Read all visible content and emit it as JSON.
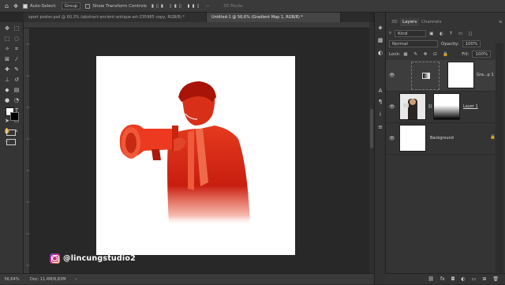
{
  "options_bar": {
    "auto_select_label": "Auto-Select:",
    "auto_select_value": "Group",
    "show_transform_label": "Show Transform Controls",
    "mode_label": "3D Mode:"
  },
  "tabs": [
    {
      "label": "sport poster.psd @ 60,3% (abstract-ancient-antique-art-235985 copy, RGB/8) *",
      "active": false
    },
    {
      "label": "Untitled-1 @ 56,6% (Gradient Map 1, RGB/8) *",
      "active": true
    }
  ],
  "status": {
    "zoom": "56,64%",
    "doc": "Doc: 11,4M/6,83M"
  },
  "layers_panel": {
    "tab_3d": "3D",
    "tab_layers": "Layers",
    "tab_channels": "Channels",
    "kind_label": "Kind",
    "blend_mode": "Normal",
    "opacity_label": "Opacity:",
    "opacity_value": "100%",
    "lock_label": "Lock:",
    "fill_label": "Fill:",
    "fill_value": "100%",
    "layers": [
      {
        "name": "Gra...p 1"
      },
      {
        "name": "Layer 1"
      },
      {
        "name": "Background"
      }
    ]
  },
  "watermark": {
    "handle": "@lincungstudio2"
  },
  "colors": {
    "accent_red": "#e43a1e",
    "canvas_white": "#ffffff",
    "instagram_purple": "#6b3cd6",
    "instagram_pink": "#d62e7a",
    "instagram_orange": "#f2a23a"
  }
}
